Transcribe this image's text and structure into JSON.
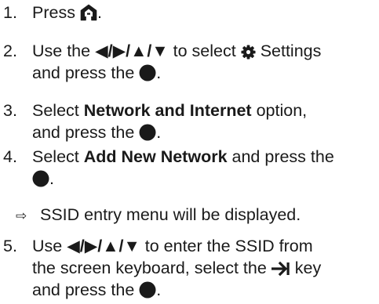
{
  "steps": [
    {
      "number": "1.",
      "text_a": "Press",
      "text_b": ".",
      "icon": "home-icon"
    },
    {
      "number": "2.",
      "text_a": "Use the",
      "arrows": "◀/▶/▲/▼",
      "text_b": "to select",
      "settings_label": "Settings",
      "text_c": "and press the",
      "text_d": ".",
      "icons": [
        "gear-icon",
        "ok-button-icon"
      ]
    },
    {
      "number": "3.",
      "text_a": "Select",
      "bold": "Network and Internet",
      "text_b": "option,",
      "text_c": "and press the",
      "text_d": ".",
      "icon": "ok-button-icon"
    },
    {
      "number": "4.",
      "text_a": "Select",
      "bold": "Add New Network",
      "text_b": "and press the",
      "text_d": ".",
      "icon": "ok-button-icon"
    },
    {
      "note_arrow": "⇨",
      "note": "SSID entry menu will be displayed."
    },
    {
      "number": "5.",
      "text_a": "Use",
      "arrows": "◀/▶/▲/▼",
      "text_b": "to enter the SSID from",
      "text_c": "the screen keyboard, select the",
      "text_d": "key",
      "text_e": "and press the",
      "text_f": ".",
      "icons": [
        "tab-key-icon",
        "ok-button-icon"
      ]
    }
  ]
}
